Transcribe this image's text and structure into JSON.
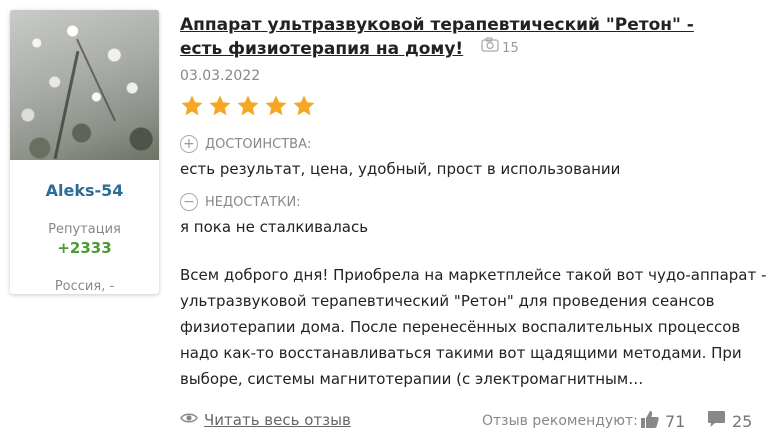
{
  "author": {
    "name": "Aleks-54",
    "reputation_label": "Репутация",
    "reputation_value": "+2333",
    "location": "Россия, -"
  },
  "review": {
    "title": "Аппарат ультразвуковой терапевтический \"Ретон\" - есть физиотерапия на дому!",
    "photo_count": "15",
    "date": "03.03.2022",
    "rating": 5,
    "rating_max": 5,
    "star_color": "#f5a623",
    "pros_label": "ДОСТОИНСТВА:",
    "pros_text": "есть результат, цена, удобный, прост в использовании",
    "cons_label": "НЕДОСТАТКИ:",
    "cons_text": "я пока не сталкивалась",
    "body": "Всем доброго дня! Приобрела на маркетплейсе такой вот чудо-аппарат - ультразвуковой терапевтический \"Ретон\" для проведения сеансов физиотерапии дома. После перенесённых воспалительных процессов надо как-то восстанавливаться такими вот щадящими методами. При выборе, системы магнитотерапии (с электромагнитным…"
  },
  "footer": {
    "read_more": "Читать весь отзыв",
    "recommend_label": "Отзыв рекомендуют:",
    "likes": "71",
    "comments": "25"
  },
  "icons": {
    "camera": "camera-icon",
    "eye": "eye-icon",
    "thumbs_up": "thumbs-up-icon",
    "comment": "comment-icon",
    "plus_circle": "plus-circle-icon",
    "minus_circle": "minus-circle-icon"
  },
  "colors": {
    "author_name": "#2c6c96",
    "reputation": "#4e9a32"
  }
}
